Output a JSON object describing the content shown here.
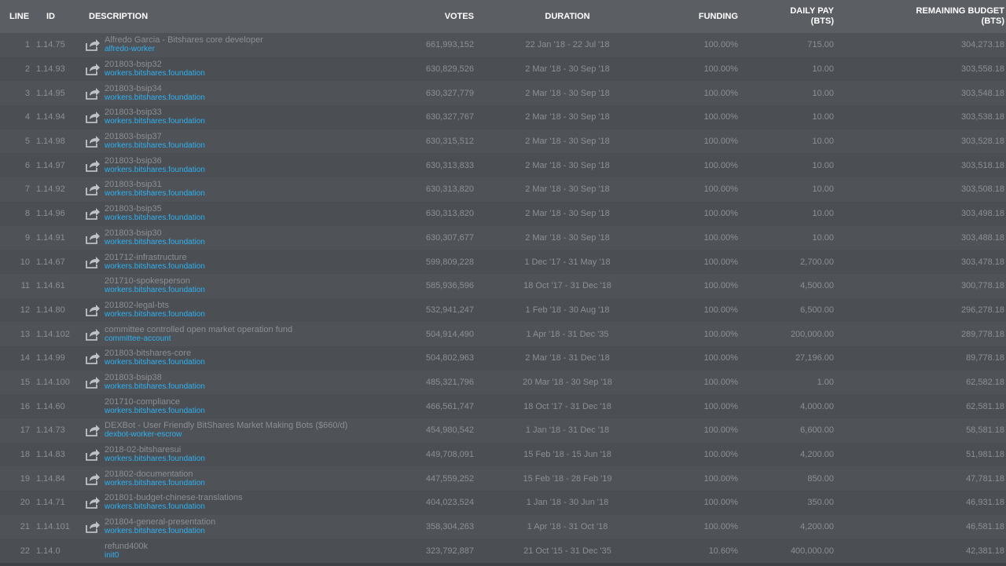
{
  "headers": {
    "line": "LINE",
    "id": "ID",
    "description": "DESCRIPTION",
    "votes": "VOTES",
    "duration": "DURATION",
    "funding": "FUNDING",
    "daily_pay": "DAILY PAY",
    "daily_pay_unit": "(BTS)",
    "remaining_budget": "REMAINING BUDGET",
    "remaining_budget_unit": "(BTS)"
  },
  "colors": {
    "link": "#2eb1f0",
    "text": "#8c8f94",
    "header_bg": "#5b5e63",
    "body_bg": "#4d5055"
  },
  "rows": [
    {
      "line": "1",
      "id": "1.14.75",
      "name": "Alfredo Garcia - Bitshares core developer",
      "account": "alfredo-worker",
      "icon": "share-icon",
      "votes": "661,993,152",
      "duration": "22 Jan '18 - 22 Jul '18",
      "funding": "100.00%",
      "daily_pay": "715.00",
      "remaining": "304,273.18"
    },
    {
      "line": "2",
      "id": "1.14.93",
      "name": "201803-bsip32",
      "account": "workers.bitshares.foundation",
      "icon": "share-icon",
      "votes": "630,829,526",
      "duration": "2 Mar '18 - 30 Sep '18",
      "funding": "100.00%",
      "daily_pay": "10.00",
      "remaining": "303,558.18"
    },
    {
      "line": "3",
      "id": "1.14.95",
      "name": "201803-bsip34",
      "account": "workers.bitshares.foundation",
      "icon": "share-icon",
      "votes": "630,327,779",
      "duration": "2 Mar '18 - 30 Sep '18",
      "funding": "100.00%",
      "daily_pay": "10.00",
      "remaining": "303,548.18"
    },
    {
      "line": "4",
      "id": "1.14.94",
      "name": "201803-bsip33",
      "account": "workers.bitshares.foundation",
      "icon": "share-icon",
      "votes": "630,327,767",
      "duration": "2 Mar '18 - 30 Sep '18",
      "funding": "100.00%",
      "daily_pay": "10.00",
      "remaining": "303,538.18"
    },
    {
      "line": "5",
      "id": "1.14.98",
      "name": "201803-bsip37",
      "account": "workers.bitshares.foundation",
      "icon": "share-icon",
      "votes": "630,315,512",
      "duration": "2 Mar '18 - 30 Sep '18",
      "funding": "100.00%",
      "daily_pay": "10.00",
      "remaining": "303,528.18"
    },
    {
      "line": "6",
      "id": "1.14.97",
      "name": "201803-bsip36",
      "account": "workers.bitshares.foundation",
      "icon": "share-icon",
      "votes": "630,313,833",
      "duration": "2 Mar '18 - 30 Sep '18",
      "funding": "100.00%",
      "daily_pay": "10.00",
      "remaining": "303,518.18"
    },
    {
      "line": "7",
      "id": "1.14.92",
      "name": "201803-bsip31",
      "account": "workers.bitshares.foundation",
      "icon": "share-icon",
      "votes": "630,313,820",
      "duration": "2 Mar '18 - 30 Sep '18",
      "funding": "100.00%",
      "daily_pay": "10.00",
      "remaining": "303,508.18"
    },
    {
      "line": "8",
      "id": "1.14.96",
      "name": "201803-bsip35",
      "account": "workers.bitshares.foundation",
      "icon": "share-icon",
      "votes": "630,313,820",
      "duration": "2 Mar '18 - 30 Sep '18",
      "funding": "100.00%",
      "daily_pay": "10.00",
      "remaining": "303,498.18"
    },
    {
      "line": "9",
      "id": "1.14.91",
      "name": "201803-bsip30",
      "account": "workers.bitshares.foundation",
      "icon": "share-icon",
      "votes": "630,307,677",
      "duration": "2 Mar '18 - 30 Sep '18",
      "funding": "100.00%",
      "daily_pay": "10.00",
      "remaining": "303,488.18"
    },
    {
      "line": "10",
      "id": "1.14.67",
      "name": "201712-infrastructure",
      "account": "workers.bitshares.foundation",
      "icon": "share-icon",
      "votes": "599,809,228",
      "duration": "1 Dec '17 - 31 May '18",
      "funding": "100.00%",
      "daily_pay": "2,700.00",
      "remaining": "303,478.18"
    },
    {
      "line": "11",
      "id": "1.14.61",
      "name": "201710-spokesperson",
      "account": "workers.bitshares.foundation",
      "icon": "",
      "votes": "585,936,596",
      "duration": "18 Oct '17 - 31 Dec '18",
      "funding": "100.00%",
      "daily_pay": "4,500.00",
      "remaining": "300,778.18"
    },
    {
      "line": "12",
      "id": "1.14.80",
      "name": "201802-legal-bts",
      "account": "workers.bitshares.foundation",
      "icon": "share-icon",
      "votes": "532,941,247",
      "duration": "1 Feb '18 - 30 Aug '18",
      "funding": "100.00%",
      "daily_pay": "6,500.00",
      "remaining": "296,278.18"
    },
    {
      "line": "13",
      "id": "1.14.102",
      "name": "committee controlled open market operation fund",
      "account": "committee-account",
      "icon": "share-icon",
      "votes": "504,914,490",
      "duration": "1 Apr '18 - 31 Dec '35",
      "funding": "100.00%",
      "daily_pay": "200,000.00",
      "remaining": "289,778.18"
    },
    {
      "line": "14",
      "id": "1.14.99",
      "name": "201803-bitshares-core",
      "account": "workers.bitshares.foundation",
      "icon": "share-icon",
      "votes": "504,802,963",
      "duration": "2 Mar '18 - 31 Dec '18",
      "funding": "100.00%",
      "daily_pay": "27,196.00",
      "remaining": "89,778.18"
    },
    {
      "line": "15",
      "id": "1.14.100",
      "name": "201803-bsip38",
      "account": "workers.bitshares.foundation",
      "icon": "share-icon",
      "votes": "485,321,796",
      "duration": "20 Mar '18 - 30 Sep '18",
      "funding": "100.00%",
      "daily_pay": "1.00",
      "remaining": "62,582.18"
    },
    {
      "line": "16",
      "id": "1.14.60",
      "name": "201710-compliance",
      "account": "workers.bitshares.foundation",
      "icon": "",
      "votes": "466,561,747",
      "duration": "18 Oct '17 - 31 Dec '18",
      "funding": "100.00%",
      "daily_pay": "4,000.00",
      "remaining": "62,581.18"
    },
    {
      "line": "17",
      "id": "1.14.73",
      "name": "DEXBot - User Friendly BitShares Market Making Bots ($660/d)",
      "account": "dexbot-worker-escrow",
      "icon": "share-icon",
      "votes": "454,980,542",
      "duration": "1 Jan '18 - 31 Dec '18",
      "funding": "100.00%",
      "daily_pay": "6,600.00",
      "remaining": "58,581.18"
    },
    {
      "line": "18",
      "id": "1.14.83",
      "name": "2018-02-bitsharesui",
      "account": "workers.bitshares.foundation",
      "icon": "share-icon",
      "votes": "449,708,091",
      "duration": "15 Feb '18 - 15 Jun '18",
      "funding": "100.00%",
      "daily_pay": "4,200.00",
      "remaining": "51,981.18"
    },
    {
      "line": "19",
      "id": "1.14.84",
      "name": "201802-documentation",
      "account": "workers.bitshares.foundation",
      "icon": "share-icon",
      "votes": "447,559,252",
      "duration": "15 Feb '18 - 28 Feb '19",
      "funding": "100.00%",
      "daily_pay": "850.00",
      "remaining": "47,781.18"
    },
    {
      "line": "20",
      "id": "1.14.71",
      "name": "201801-budget-chinese-translations",
      "account": "workers.bitshares.foundation",
      "icon": "share-icon",
      "votes": "404,023,524",
      "duration": "1 Jan '18 - 30 Jun '18",
      "funding": "100.00%",
      "daily_pay": "350.00",
      "remaining": "46,931.18"
    },
    {
      "line": "21",
      "id": "1.14.101",
      "name": "201804-general-presentation",
      "account": "workers.bitshares.foundation",
      "icon": "share-icon",
      "votes": "358,304,263",
      "duration": "1 Apr '18 - 31 Oct '18",
      "funding": "100.00%",
      "daily_pay": "4,200.00",
      "remaining": "46,581.18"
    },
    {
      "line": "22",
      "id": "1.14.0",
      "name": "refund400k",
      "account": "init0",
      "icon": "",
      "votes": "323,792,887",
      "duration": "21 Oct '15 - 31 Dec '35",
      "funding": "10.60%",
      "daily_pay": "400,000.00",
      "remaining": "42,381.18"
    }
  ]
}
